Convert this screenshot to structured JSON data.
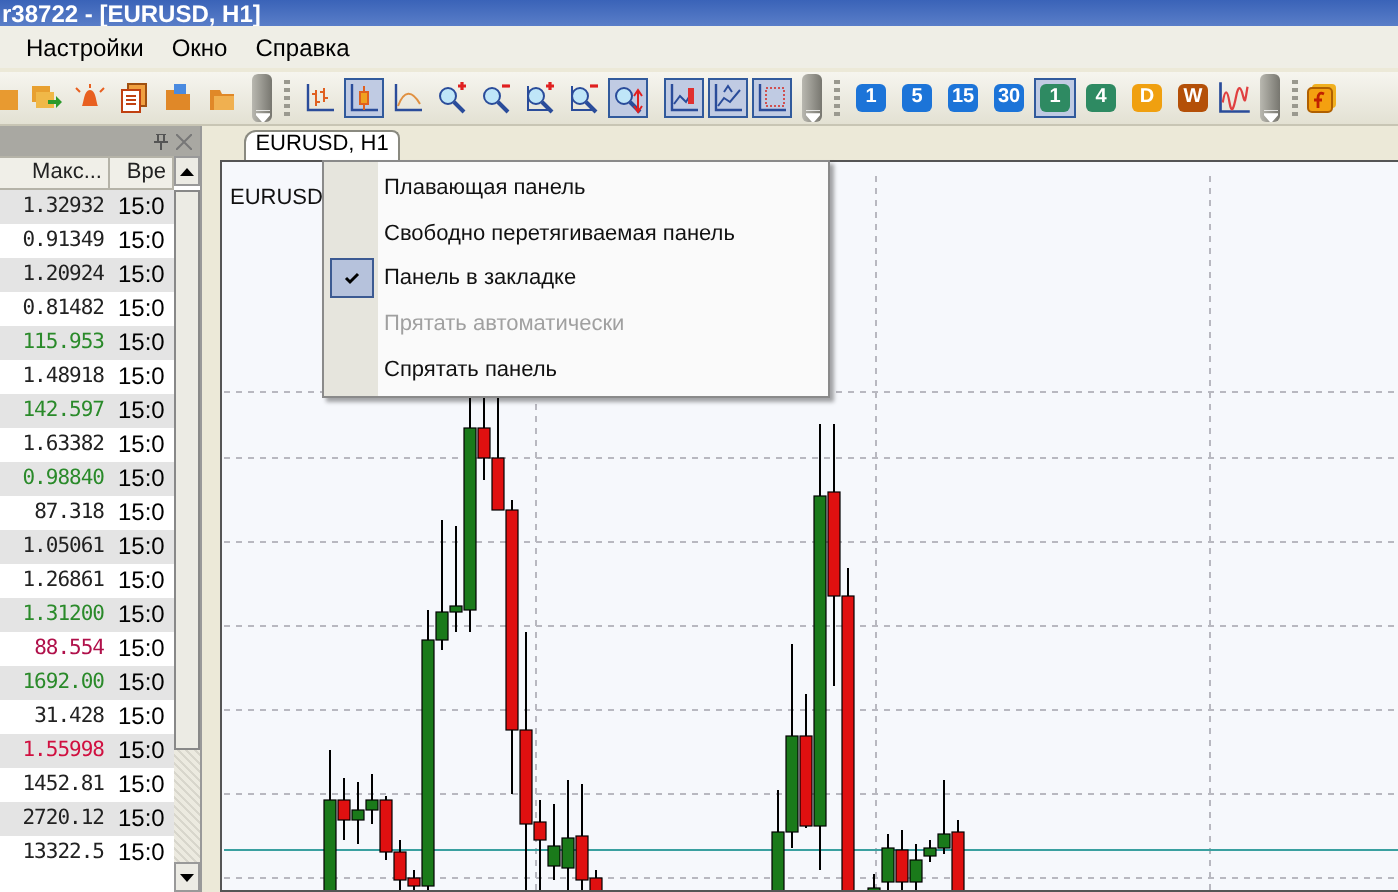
{
  "window": {
    "title": "r38722 - [EURUSD, H1]"
  },
  "menu": [
    {
      "label": "Настройки"
    },
    {
      "label": "Окно"
    },
    {
      "label": "Справка"
    }
  ],
  "toolbar": {
    "icon_buttons": [
      {
        "pressed": false
      },
      {
        "pressed": false
      },
      {
        "pressed": false
      },
      {
        "pressed": false
      },
      {
        "pressed": false
      },
      {
        "pressed": false
      },
      {
        "pressed": false
      },
      {
        "pressed": true
      },
      {
        "pressed": false
      },
      {
        "pressed": false
      },
      {
        "pressed": false
      },
      {
        "pressed": false
      },
      {
        "pressed": false
      },
      {
        "pressed": true
      },
      {
        "pressed": true
      },
      {
        "pressed": true
      },
      {
        "pressed": true
      }
    ],
    "timeframes": [
      {
        "label": "1",
        "selected": false,
        "color": "#1c74d8"
      },
      {
        "label": "5",
        "selected": false,
        "color": "#1c74d8"
      },
      {
        "label": "15",
        "selected": false,
        "color": "#1c74d8"
      },
      {
        "label": "30",
        "selected": false,
        "color": "#1c74d8"
      },
      {
        "label": "1",
        "selected": true,
        "color": "#2e8a62"
      },
      {
        "label": "4",
        "selected": false,
        "color": "#2e8a62"
      },
      {
        "label": "D",
        "selected": false,
        "color": "#f0a010"
      },
      {
        "label": "W",
        "selected": false,
        "color": "#b45008"
      }
    ]
  },
  "market_watch": {
    "columns": [
      "Макс...",
      "Вре"
    ],
    "rows": [
      {
        "high": "1.32932",
        "time": "15:0",
        "color": "#222222"
      },
      {
        "high": "0.91349",
        "time": "15:0",
        "color": "#222222"
      },
      {
        "high": "1.20924",
        "time": "15:0",
        "color": "#222222"
      },
      {
        "high": "0.81482",
        "time": "15:0",
        "color": "#222222"
      },
      {
        "high": "115.953",
        "time": "15:0",
        "color": "#2a8a2a"
      },
      {
        "high": "1.48918",
        "time": "15:0",
        "color": "#222222"
      },
      {
        "high": "142.597",
        "time": "15:0",
        "color": "#2a8a2a"
      },
      {
        "high": "1.63382",
        "time": "15:0",
        "color": "#222222"
      },
      {
        "high": "0.98840",
        "time": "15:0",
        "color": "#2a8a2a"
      },
      {
        "high": "87.318",
        "time": "15:0",
        "color": "#222222"
      },
      {
        "high": "1.05061",
        "time": "15:0",
        "color": "#222222"
      },
      {
        "high": "1.26861",
        "time": "15:0",
        "color": "#222222"
      },
      {
        "high": "1.31200",
        "time": "15:0",
        "color": "#2a8a2a"
      },
      {
        "high": "88.554",
        "time": "15:0",
        "color": "#b0104a"
      },
      {
        "high": "1692.00",
        "time": "15:0",
        "color": "#2a8a2a"
      },
      {
        "high": "31.428",
        "time": "15:0",
        "color": "#222222"
      },
      {
        "high": "1.55998",
        "time": "15:0",
        "color": "#d01040"
      },
      {
        "high": "1452.81",
        "time": "15:0",
        "color": "#222222"
      },
      {
        "high": "2720.12",
        "time": "15:0",
        "color": "#222222"
      },
      {
        "high": "13322.5",
        "time": "15:0",
        "color": "#222222"
      }
    ]
  },
  "chart": {
    "tab": {
      "label": "EURUSD, H1",
      "selected": true
    },
    "label": "EURUSD"
  },
  "context_menu": [
    {
      "label": "Плавающая панель",
      "checked": false,
      "disabled": false
    },
    {
      "label": "Свободно перетягиваемая панель",
      "checked": false,
      "disabled": false
    },
    {
      "label": "Панель в закладке",
      "checked": true,
      "disabled": false
    },
    {
      "label": "Прятать автоматически",
      "checked": false,
      "disabled": true
    },
    {
      "label": "Спрятать панель",
      "checked": false,
      "disabled": false
    }
  ]
}
